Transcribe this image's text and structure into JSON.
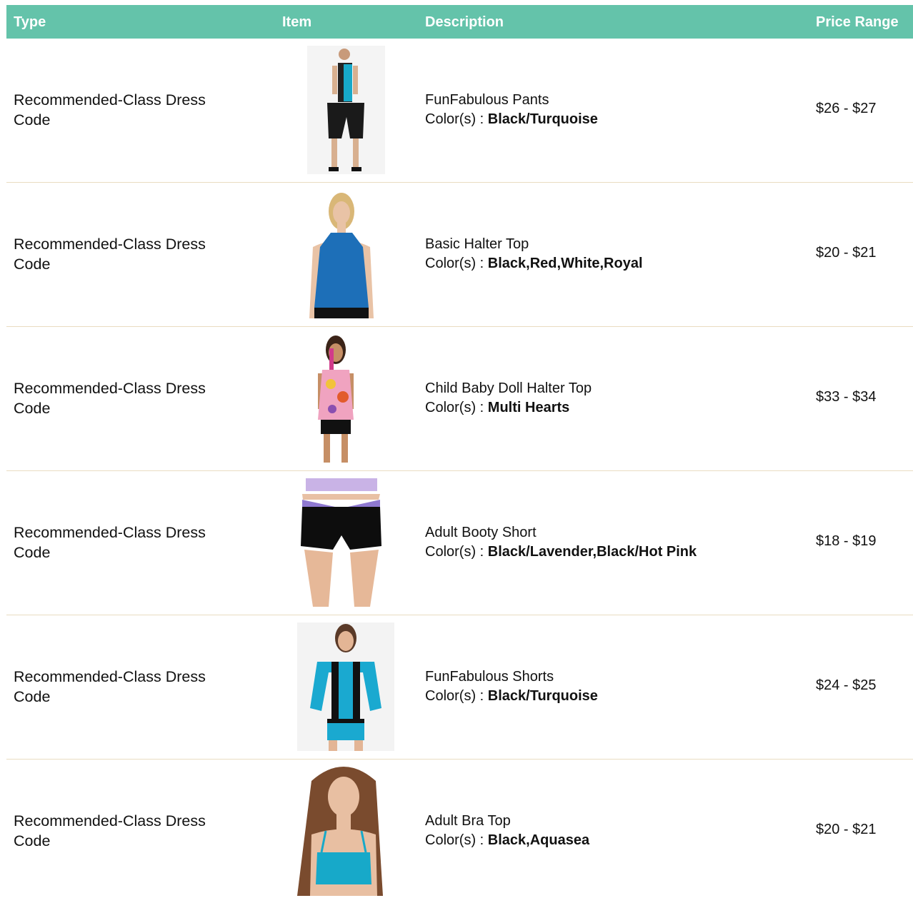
{
  "headers": {
    "type": "Type",
    "item": "Item",
    "description": "Description",
    "price": "Price Range"
  },
  "color_prefix": "Color(s) : ",
  "rows": [
    {
      "type": "Recommended-Class Dress Code",
      "name": "FunFabulous Pants",
      "colors": "Black/Turquoise",
      "price": "$26 - $27",
      "image": "girl-pants-photo"
    },
    {
      "type": "Recommended-Class Dress Code",
      "name": "Basic Halter Top",
      "colors": "Black,Red,White,Royal",
      "price": "$20 - $21",
      "image": "halter-top-photo"
    },
    {
      "type": "Recommended-Class Dress Code",
      "name": "Child Baby Doll Halter Top",
      "colors": "Multi Hearts",
      "price": "$33 - $34",
      "image": "baby-doll-top-photo"
    },
    {
      "type": "Recommended-Class Dress Code",
      "name": "Adult Booty Short",
      "colors": "Black/Lavender,Black/Hot Pink",
      "price": "$18 - $19",
      "image": "booty-short-photo"
    },
    {
      "type": "Recommended-Class Dress Code",
      "name": "FunFabulous Shorts",
      "colors": "Black/Turquoise",
      "price": "$24 - $25",
      "image": "shorts-photo"
    },
    {
      "type": "Recommended-Class Dress Code",
      "name": "Adult Bra Top",
      "colors": "Black,Aquasea",
      "price": "$20 - $21",
      "image": "bra-top-photo"
    }
  ],
  "colors": {
    "header_bg": "#64c3aa",
    "row_border": "#e9dcc1",
    "header_text": "#ffffff"
  }
}
